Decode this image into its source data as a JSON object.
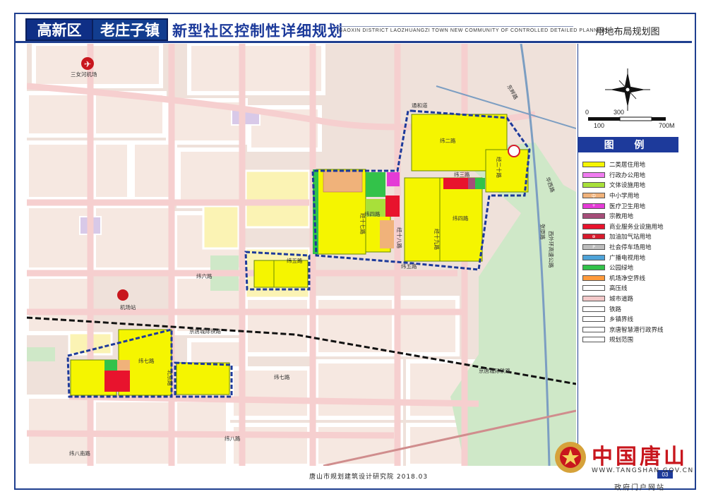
{
  "header": {
    "district": "高新区",
    "town": "老庄子镇",
    "title": "新型社区控制性详细规划",
    "title_en": "GAOXIN DISTRICT LAOZHUANGZI TOWN NEW COMMUNITY OF CONTROLLED DETAILED PLANNING",
    "sheet_name": "用地布局规划图"
  },
  "scale": {
    "labels_top": [
      "0",
      "300"
    ],
    "labels_bottom": [
      "100",
      "700M"
    ]
  },
  "legend": {
    "title": "图 例",
    "items": [
      {
        "label": "二类居住用地",
        "color": "#f5f500",
        "glyph": ""
      },
      {
        "label": "行政办公用地",
        "color": "#f07cf0",
        "glyph": ""
      },
      {
        "label": "文体设施用地",
        "color": "#a8e03a",
        "glyph": ""
      },
      {
        "label": "中小学用地",
        "color": "#f0b27a",
        "glyph": "中"
      },
      {
        "label": "医疗卫生用地",
        "color": "#e43bd6",
        "glyph": "+"
      },
      {
        "label": "宗教用地",
        "color": "#a64d79",
        "glyph": ""
      },
      {
        "label": "商业服务业设施用地",
        "color": "#e8132d",
        "glyph": ""
      },
      {
        "label": "加油加气站用地",
        "color": "#d71a2c",
        "glyph": "⊕"
      },
      {
        "label": "社会停车场用地",
        "color": "#bdbdbd",
        "glyph": "P"
      },
      {
        "label": "广播电视用地",
        "color": "#4ea3d8",
        "glyph": ""
      },
      {
        "label": "公园绿地",
        "color": "#33c24a",
        "glyph": ""
      },
      {
        "label": "机场净空界线",
        "color": "#ff9a3c",
        "glyph": ""
      },
      {
        "label": "高压线",
        "color": "#ffffff",
        "glyph": ""
      },
      {
        "label": "城市道路",
        "color": "#f3c9c9",
        "glyph": ""
      },
      {
        "label": "铁路",
        "color": "#ffffff",
        "glyph": ""
      },
      {
        "label": "乡镇界线",
        "color": "#ffffff",
        "glyph": ""
      },
      {
        "label": "京唐智慧港行政界线",
        "color": "#ffffff",
        "glyph": ""
      },
      {
        "label": "规划范围",
        "color": "#ffffff",
        "glyph": ""
      }
    ]
  },
  "map_labels": {
    "airport": "三女河机场",
    "station": "机场站",
    "railway_1": "京唐城际铁路",
    "railway_2": "京唐城际铁路",
    "road_tonghe": "通和道",
    "road_wei2": "纬二路",
    "road_wei3": "纬三路",
    "road_wei4": "纬四路",
    "road_wei4b": "纬四路",
    "road_wei5": "纬五路",
    "road_wei5b": "纬五路",
    "road_wei6": "纬六路",
    "road_wei7": "纬七路",
    "road_wei7b": "纬七路",
    "road_wei8": "纬八路",
    "road_wei8b": "纬八南路",
    "road_jing17": "经十七路",
    "road_jing18": "经十八路",
    "road_jing19": "经十九路",
    "road_jing20": "经二十路",
    "road_beijing": "北京路",
    "road_expressway": "西外环高速公路",
    "road_zhangyuan": "张原路",
    "road_dongpan": "东畔路",
    "road_huaxi": "华西路"
  },
  "footer": {
    "institute": "唐山市规划建筑设计研究院 2018.03",
    "page": "03"
  },
  "watermark": {
    "cn": "中国唐山",
    "url": "WWW.TANGSHAN.GOV.CN",
    "sub": "政府门户网站"
  }
}
